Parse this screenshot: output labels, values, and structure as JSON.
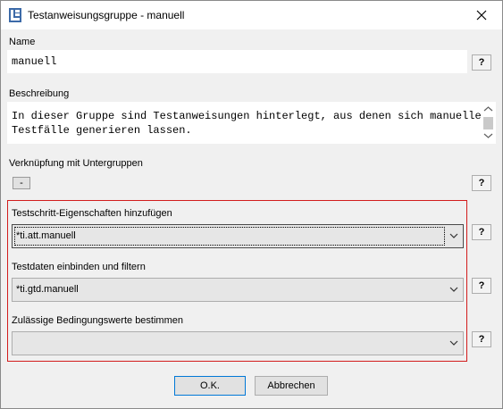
{
  "window": {
    "title": "Testanweisungsgruppe - manuell",
    "icon": "app-icon",
    "close_icon": "close-icon"
  },
  "name_section": {
    "label": "Name",
    "value": "manuell",
    "help": "?"
  },
  "description_section": {
    "label": "Beschreibung",
    "text_line1": "In dieser Gruppe sind Testanweisungen hinterlegt, aus denen sich manuelle",
    "text_line2": "Testfälle generieren lassen."
  },
  "subgroups_section": {
    "label": "Verknüpfung mit Untergruppen",
    "minus_label": "-",
    "help": "?"
  },
  "step_properties": {
    "label": "Testschritt-Eigenschaften hinzufügen",
    "value": "*ti.att.manuell",
    "help": "?"
  },
  "test_data": {
    "label": "Testdaten einbinden und filtern",
    "value": "*ti.gtd.manuell",
    "help": "?"
  },
  "condition_values": {
    "label": "Zulässige Bedingungswerte bestimmen",
    "value": "",
    "help": "?"
  },
  "footer": {
    "ok_label": "O.K.",
    "cancel_label": "Abbrechen"
  },
  "colors": {
    "highlight_border": "#d21c1c",
    "default_button_border": "#0078d7",
    "dialog_background": "#f0f0f0"
  }
}
